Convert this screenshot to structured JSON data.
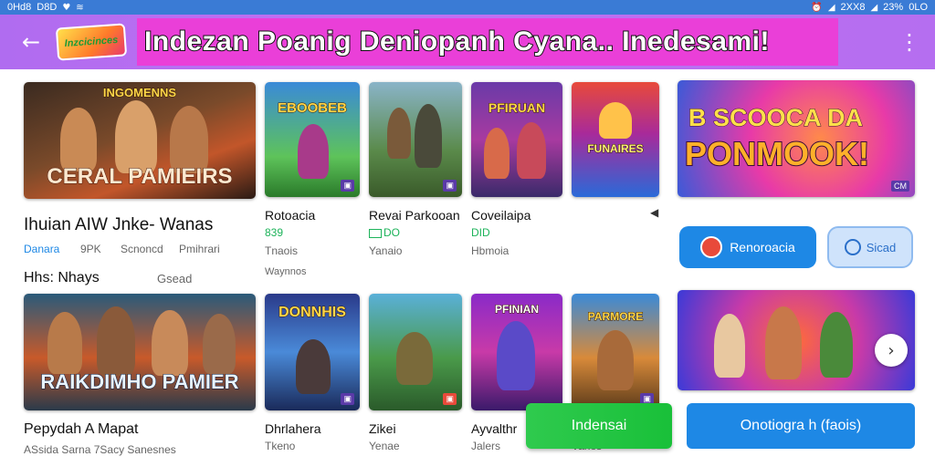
{
  "status_bar": {
    "time": "0Hd8",
    "left_extra": "D8D",
    "signal": "2XX8",
    "battery": "23%",
    "clock_right": "0LO"
  },
  "header": {
    "logo_text": "Inzcicinces",
    "title": "Indezan Poanig Deniopanh Cyana.. Inedesami!"
  },
  "feature": {
    "title": "Ihuian AIW Jnke- Wanas",
    "tags": [
      "Danara",
      "9PK",
      "Scnoncd",
      "Pmihrari"
    ],
    "hero_text": "CERAL PAMIEIRS",
    "hero_top": "INGOMENNS"
  },
  "section2": {
    "label": "Hhs: Nhays",
    "extra": "Gsead"
  },
  "row1_games": [
    {
      "title": "Rotoacia",
      "rating": "839",
      "sub": "Tnaois",
      "sub2": "Waynnos",
      "top": "EBOOBEB"
    },
    {
      "title": "Revai Parkooan",
      "rating": "DO",
      "sub": "Yanaio",
      "top": ""
    },
    {
      "title": "Coveilaipa",
      "rating": "DID",
      "sub": "Hbmoia",
      "top": "PFIRUAN"
    },
    {
      "title": "",
      "rating": "",
      "sub": "",
      "top": "FUNAIRES"
    }
  ],
  "promo_banner": {
    "line1": "B SCOOCA DA",
    "line2": "PONMOOK!",
    "tag": "CM"
  },
  "buttons": {
    "primary": "Renoroacia",
    "secondary": "Sicad",
    "install": "Indensai",
    "open": "Onotiogra h (faois)"
  },
  "row2_feature": {
    "title": "Pepydah A Mapat",
    "sub": "ASsida Sarna 7Sacy Sanesnes",
    "hero_text": "RAIKDIMHO PAMIER"
  },
  "row2_games": [
    {
      "title": "Dhrlahera",
      "sub": "Tkeno",
      "top": "DONNHIS"
    },
    {
      "title": "Zikei",
      "sub": "Yenae",
      "top": ""
    },
    {
      "title": "Ayvalthr",
      "sub": "Jalers",
      "top": "PFINIAN"
    },
    {
      "title": "",
      "sub": "Vanos",
      "top": "PARMORE"
    }
  ],
  "colors": {
    "header": "#b56ef0",
    "title_bg": "#ea3fd8",
    "primary_blue": "#1e88e5",
    "install_green": "#2fca4e"
  }
}
